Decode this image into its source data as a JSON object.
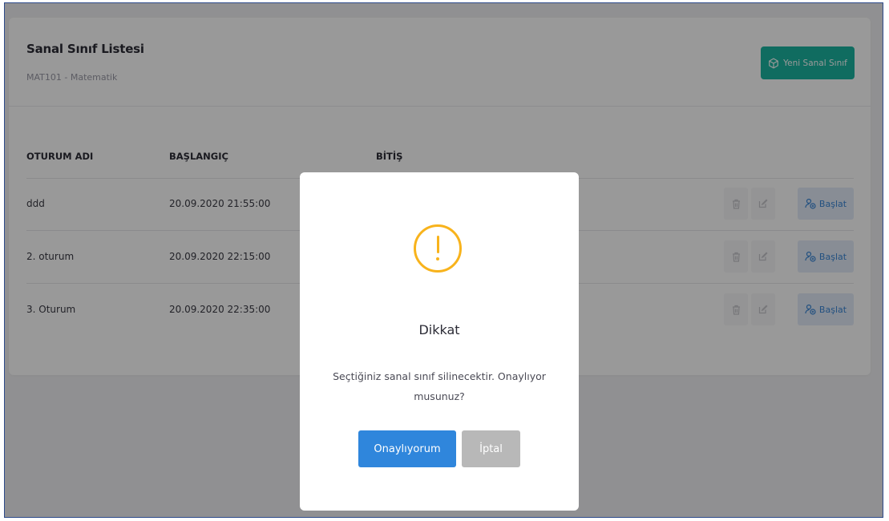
{
  "page": {
    "title": "Sanal Sınıf Listesi",
    "subtitle": "MAT101 - Matematik",
    "new_button_label": "Yeni Sanal Sınıf"
  },
  "table": {
    "headers": [
      "OTURUM ADI",
      "BAŞLANGIÇ",
      "BİTİŞ"
    ],
    "rows": [
      {
        "name": "ddd",
        "start": "20.09.2020 21:55:00",
        "start_button_label": "Başlat"
      },
      {
        "name": "2. oturum",
        "start": "20.09.2020 22:15:00",
        "start_button_label": "Başlat"
      },
      {
        "name": "3. Oturum",
        "start": "20.09.2020 22:35:00",
        "start_button_label": "Başlat"
      }
    ]
  },
  "dialog": {
    "icon": "warning-icon",
    "title": "Dikkat",
    "message": "Seçtiğiniz sanal sınıf silinecektir. Onaylıyor musunuz?",
    "confirm_label": "Onaylıyorum",
    "cancel_label": "İptal"
  },
  "colors": {
    "primary": "#2f86dc",
    "success": "#1bb5a0",
    "warning": "#f8b31c",
    "muted": "#b8b8b8"
  }
}
